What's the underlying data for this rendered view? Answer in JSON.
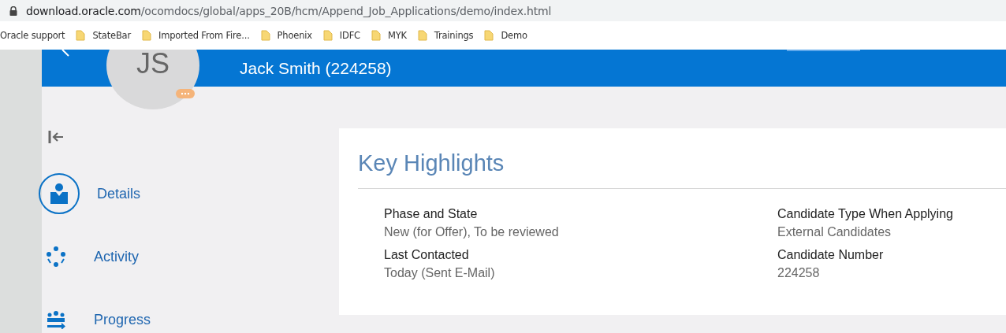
{
  "browser": {
    "url_host": "download.oracle.com",
    "url_path": "/ocomdocs/global/apps_20B/hcm/Append_Job_Applications/demo/index.html",
    "bookmarks": [
      "Oracle support",
      "StateBar",
      "Imported From Fire...",
      "Phoenix",
      "IDFC",
      "MYK",
      "Trainings",
      "Demo"
    ]
  },
  "header": {
    "initials": "JS",
    "title": "Jack Smith (224258)"
  },
  "sidebar": {
    "items": [
      {
        "label": "Details",
        "kind": "person",
        "selected": true
      },
      {
        "label": "Activity",
        "kind": "cycle",
        "selected": false
      },
      {
        "label": "Progress",
        "kind": "group",
        "selected": false
      }
    ]
  },
  "card": {
    "title": "Key Highlights",
    "fields": [
      {
        "label": "Phase and State",
        "value": "New (for Offer), To be reviewed"
      },
      {
        "label": "Candidate Type When Applying",
        "value": "External Candidates"
      },
      {
        "label": "Last Contacted",
        "value": "Today (Sent E-Mail)"
      },
      {
        "label": "Candidate Number",
        "value": "224258"
      }
    ]
  }
}
